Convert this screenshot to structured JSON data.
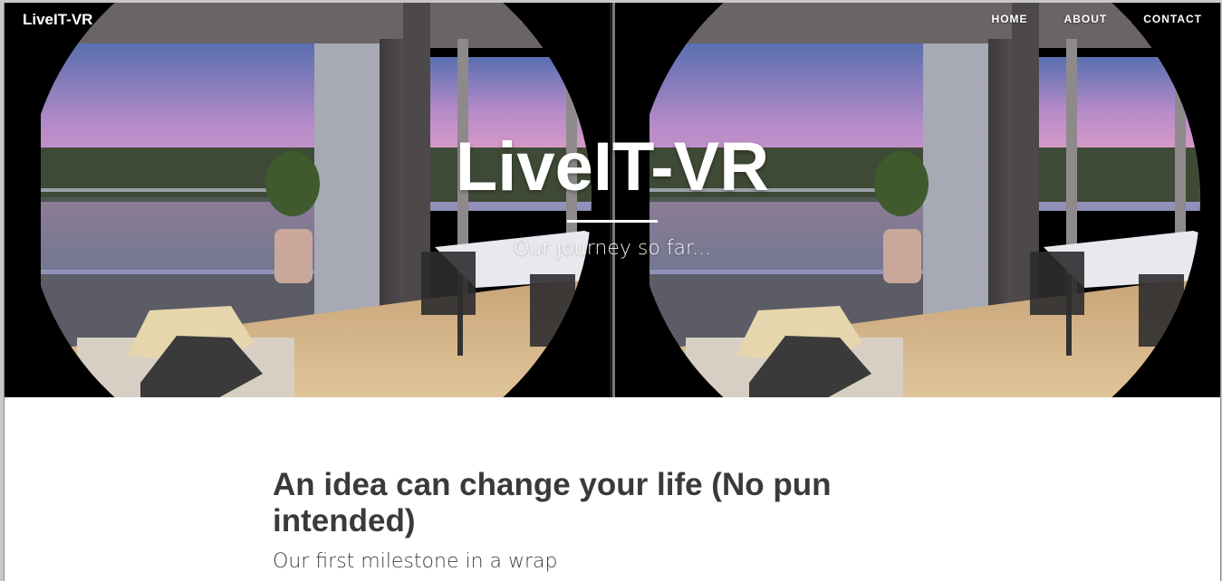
{
  "navbar": {
    "brand": "LiveIT-VR",
    "links": [
      {
        "label": "HOME"
      },
      {
        "label": "ABOUT"
      },
      {
        "label": "CONTACT"
      }
    ]
  },
  "hero": {
    "title": "LiveIT-VR",
    "subtitle": "Our journey so far..."
  },
  "posts": [
    {
      "title": "An idea can change your life (No pun intended)",
      "subtitle": "Our first milestone in a wrap"
    }
  ],
  "colors": {
    "hero_text": "#ffffff",
    "post_title": "#3a3a3a",
    "post_subtitle": "#404040",
    "page_background": "#ffffff"
  }
}
